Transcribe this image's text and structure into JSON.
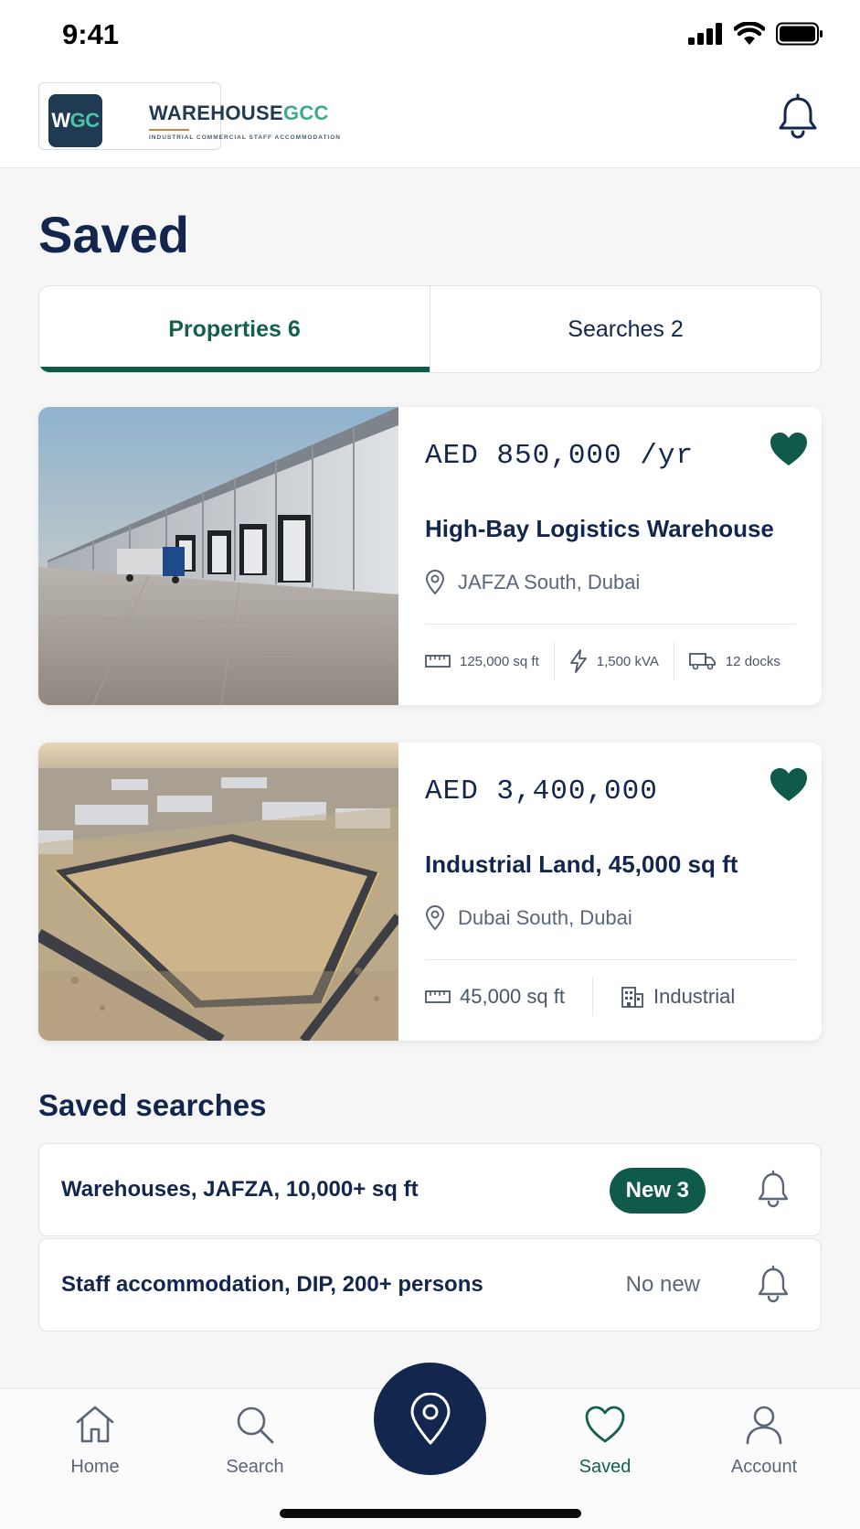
{
  "status_bar": {
    "time": "9:41"
  },
  "brand": {
    "badge_w": "W",
    "badge_gc": "GC",
    "name_main": "WAREHOUSE",
    "name_accent": "GCC",
    "tagline": "INDUSTRIAL COMMERCIAL STAFF ACCOMMODATION",
    "brand_color": "#1f3a52",
    "accent_color": "#3daa8c"
  },
  "page": {
    "title": "Saved"
  },
  "tabs": [
    {
      "label": "Properties 6",
      "active": true
    },
    {
      "label": "Searches 2",
      "active": false
    }
  ],
  "properties": [
    {
      "price": "AED 850,000 /yr",
      "title": "High-Bay Logistics Warehouse",
      "location": "JAFZA South, Dubai",
      "specs": [
        {
          "icon": "ruler-icon",
          "text": "125,000 sq ft"
        },
        {
          "icon": "lightning-icon",
          "text": "1,500 kVA"
        },
        {
          "icon": "truck-icon",
          "text": "12 docks"
        }
      ],
      "saved": true
    },
    {
      "price": "AED 3,400,000",
      "title": "Industrial Land, 45,000 sq ft",
      "location": "Dubai South, Dubai",
      "specs": [
        {
          "icon": "ruler-icon",
          "text": "45,000 sq ft"
        },
        {
          "icon": "building-icon",
          "text": "Industrial"
        }
      ],
      "saved": true
    }
  ],
  "saved_searches": {
    "title": "Saved searches",
    "items": [
      {
        "label": "Warehouses, JAFZA, 10,000+ sq ft",
        "status": "New 3",
        "has_new": true
      },
      {
        "label": "Staff accommodation, DIP, 200+ persons",
        "status": "No new",
        "has_new": false
      }
    ]
  },
  "nav": {
    "items": [
      {
        "label": "Home",
        "icon": "home-icon"
      },
      {
        "label": "Search",
        "icon": "search-icon"
      },
      {
        "label": "Saved",
        "icon": "heart-icon",
        "active": true
      },
      {
        "label": "Account",
        "icon": "person-icon"
      }
    ],
    "center_icon": "map-pin-icon"
  },
  "colors": {
    "navy": "#13264d",
    "green": "#0f5a4b",
    "muted": "#5b6678"
  }
}
